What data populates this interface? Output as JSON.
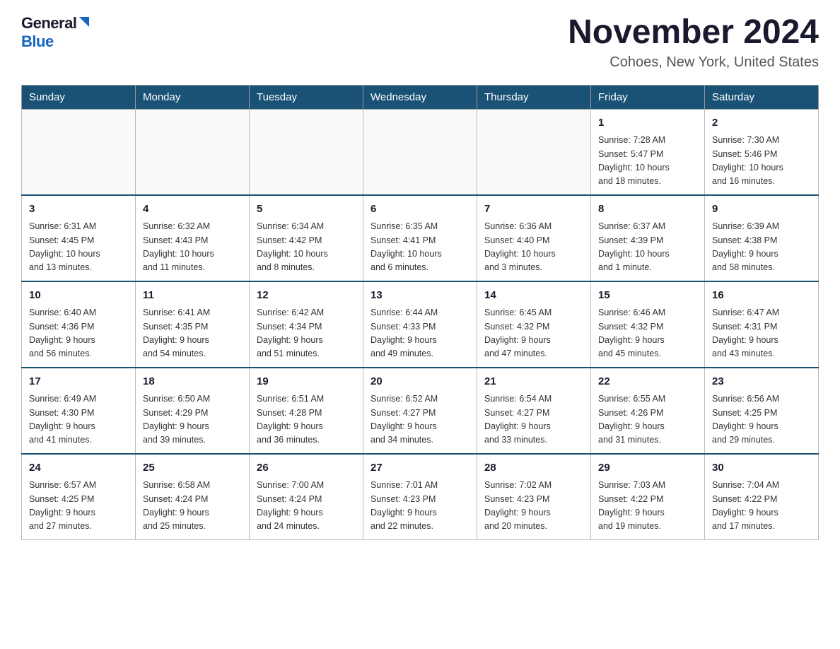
{
  "header": {
    "logo_general": "General",
    "logo_blue": "Blue",
    "month_title": "November 2024",
    "location": "Cohoes, New York, United States"
  },
  "days_of_week": [
    "Sunday",
    "Monday",
    "Tuesday",
    "Wednesday",
    "Thursday",
    "Friday",
    "Saturday"
  ],
  "weeks": [
    {
      "days": [
        {
          "num": "",
          "info": ""
        },
        {
          "num": "",
          "info": ""
        },
        {
          "num": "",
          "info": ""
        },
        {
          "num": "",
          "info": ""
        },
        {
          "num": "",
          "info": ""
        },
        {
          "num": "1",
          "info": "Sunrise: 7:28 AM\nSunset: 5:47 PM\nDaylight: 10 hours\nand 18 minutes."
        },
        {
          "num": "2",
          "info": "Sunrise: 7:30 AM\nSunset: 5:46 PM\nDaylight: 10 hours\nand 16 minutes."
        }
      ]
    },
    {
      "days": [
        {
          "num": "3",
          "info": "Sunrise: 6:31 AM\nSunset: 4:45 PM\nDaylight: 10 hours\nand 13 minutes."
        },
        {
          "num": "4",
          "info": "Sunrise: 6:32 AM\nSunset: 4:43 PM\nDaylight: 10 hours\nand 11 minutes."
        },
        {
          "num": "5",
          "info": "Sunrise: 6:34 AM\nSunset: 4:42 PM\nDaylight: 10 hours\nand 8 minutes."
        },
        {
          "num": "6",
          "info": "Sunrise: 6:35 AM\nSunset: 4:41 PM\nDaylight: 10 hours\nand 6 minutes."
        },
        {
          "num": "7",
          "info": "Sunrise: 6:36 AM\nSunset: 4:40 PM\nDaylight: 10 hours\nand 3 minutes."
        },
        {
          "num": "8",
          "info": "Sunrise: 6:37 AM\nSunset: 4:39 PM\nDaylight: 10 hours\nand 1 minute."
        },
        {
          "num": "9",
          "info": "Sunrise: 6:39 AM\nSunset: 4:38 PM\nDaylight: 9 hours\nand 58 minutes."
        }
      ]
    },
    {
      "days": [
        {
          "num": "10",
          "info": "Sunrise: 6:40 AM\nSunset: 4:36 PM\nDaylight: 9 hours\nand 56 minutes."
        },
        {
          "num": "11",
          "info": "Sunrise: 6:41 AM\nSunset: 4:35 PM\nDaylight: 9 hours\nand 54 minutes."
        },
        {
          "num": "12",
          "info": "Sunrise: 6:42 AM\nSunset: 4:34 PM\nDaylight: 9 hours\nand 51 minutes."
        },
        {
          "num": "13",
          "info": "Sunrise: 6:44 AM\nSunset: 4:33 PM\nDaylight: 9 hours\nand 49 minutes."
        },
        {
          "num": "14",
          "info": "Sunrise: 6:45 AM\nSunset: 4:32 PM\nDaylight: 9 hours\nand 47 minutes."
        },
        {
          "num": "15",
          "info": "Sunrise: 6:46 AM\nSunset: 4:32 PM\nDaylight: 9 hours\nand 45 minutes."
        },
        {
          "num": "16",
          "info": "Sunrise: 6:47 AM\nSunset: 4:31 PM\nDaylight: 9 hours\nand 43 minutes."
        }
      ]
    },
    {
      "days": [
        {
          "num": "17",
          "info": "Sunrise: 6:49 AM\nSunset: 4:30 PM\nDaylight: 9 hours\nand 41 minutes."
        },
        {
          "num": "18",
          "info": "Sunrise: 6:50 AM\nSunset: 4:29 PM\nDaylight: 9 hours\nand 39 minutes."
        },
        {
          "num": "19",
          "info": "Sunrise: 6:51 AM\nSunset: 4:28 PM\nDaylight: 9 hours\nand 36 minutes."
        },
        {
          "num": "20",
          "info": "Sunrise: 6:52 AM\nSunset: 4:27 PM\nDaylight: 9 hours\nand 34 minutes."
        },
        {
          "num": "21",
          "info": "Sunrise: 6:54 AM\nSunset: 4:27 PM\nDaylight: 9 hours\nand 33 minutes."
        },
        {
          "num": "22",
          "info": "Sunrise: 6:55 AM\nSunset: 4:26 PM\nDaylight: 9 hours\nand 31 minutes."
        },
        {
          "num": "23",
          "info": "Sunrise: 6:56 AM\nSunset: 4:25 PM\nDaylight: 9 hours\nand 29 minutes."
        }
      ]
    },
    {
      "days": [
        {
          "num": "24",
          "info": "Sunrise: 6:57 AM\nSunset: 4:25 PM\nDaylight: 9 hours\nand 27 minutes."
        },
        {
          "num": "25",
          "info": "Sunrise: 6:58 AM\nSunset: 4:24 PM\nDaylight: 9 hours\nand 25 minutes."
        },
        {
          "num": "26",
          "info": "Sunrise: 7:00 AM\nSunset: 4:24 PM\nDaylight: 9 hours\nand 24 minutes."
        },
        {
          "num": "27",
          "info": "Sunrise: 7:01 AM\nSunset: 4:23 PM\nDaylight: 9 hours\nand 22 minutes."
        },
        {
          "num": "28",
          "info": "Sunrise: 7:02 AM\nSunset: 4:23 PM\nDaylight: 9 hours\nand 20 minutes."
        },
        {
          "num": "29",
          "info": "Sunrise: 7:03 AM\nSunset: 4:22 PM\nDaylight: 9 hours\nand 19 minutes."
        },
        {
          "num": "30",
          "info": "Sunrise: 7:04 AM\nSunset: 4:22 PM\nDaylight: 9 hours\nand 17 minutes."
        }
      ]
    }
  ]
}
